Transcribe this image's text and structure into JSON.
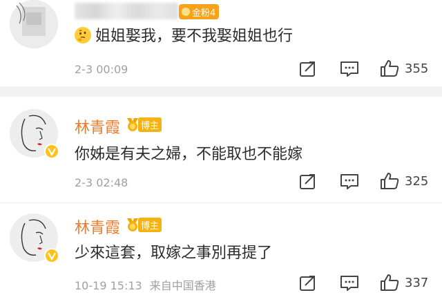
{
  "comments": [
    {
      "username": "",
      "fan_badge": "金粉4",
      "text": "姐姐娶我，要不我娶姐姐也行",
      "time": "2-3 00:09",
      "source": "",
      "likes": "355",
      "emoji_icon": "thinking-face-emoji"
    },
    {
      "username": "林青霞",
      "badge": "博主",
      "text": "你姊是有夫之婦，不能取也不能嫁",
      "time": "2-3 02:48",
      "source": "",
      "likes": "325"
    },
    {
      "username": "林青霞",
      "badge": "博主",
      "text": "少來這套，取嫁之事別再提了",
      "time": "10-19 15:13",
      "source": "来自中国香港",
      "likes": "337"
    }
  ],
  "colors": {
    "username": "#ea7c2b",
    "badge": "#f5b312",
    "meta": "#a0a0a0",
    "separator": "#f2f2f2"
  },
  "icons": [
    "share-icon",
    "comment-icon",
    "like-icon"
  ]
}
